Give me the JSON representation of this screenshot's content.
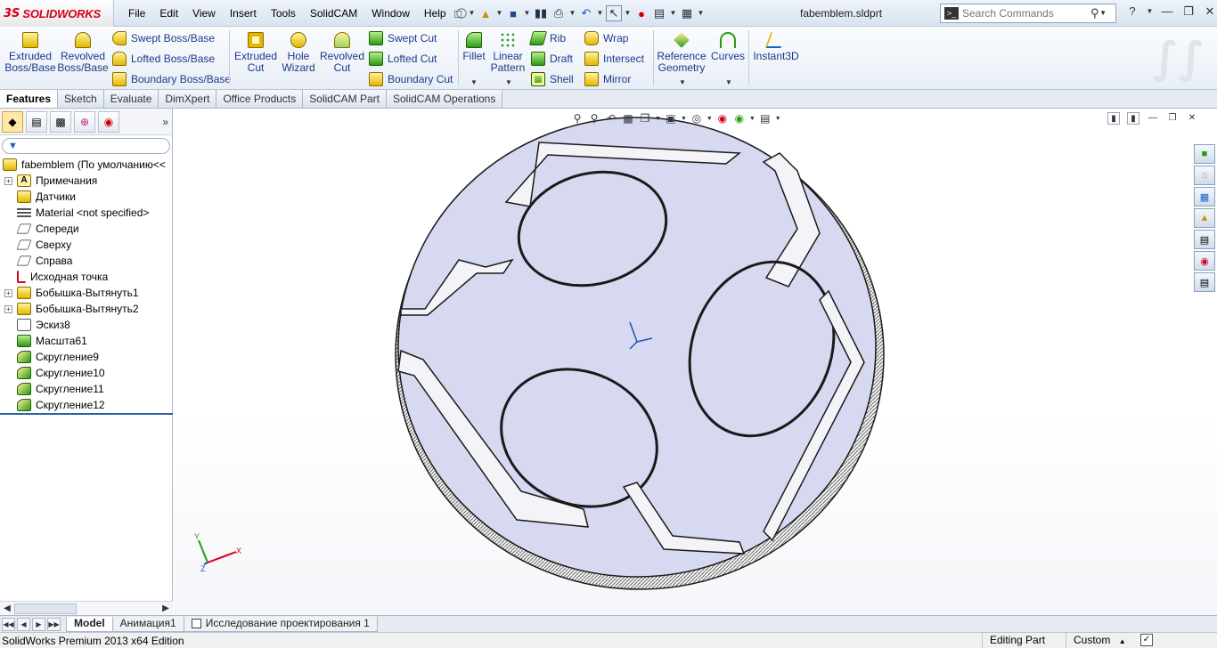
{
  "app": {
    "logo_prefix": "3S",
    "logo_text": "SOLIDWORKS",
    "document_title": "fabemblem.sldprt"
  },
  "menu": [
    "File",
    "Edit",
    "View",
    "Insert",
    "Tools",
    "SolidCAM",
    "Window",
    "Help"
  ],
  "search": {
    "placeholder": "Search Commands"
  },
  "commands": {
    "extruded_boss": "Extruded Boss/Base",
    "revolved_boss": "Revolved Boss/Base",
    "swept_boss": "Swept Boss/Base",
    "lofted_boss": "Lofted Boss/Base",
    "boundary_boss": "Boundary Boss/Base",
    "extruded_cut": "Extruded Cut",
    "hole_wizard": "Hole Wizard",
    "revolved_cut": "Revolved Cut",
    "swept_cut": "Swept Cut",
    "lofted_cut": "Lofted Cut",
    "boundary_cut": "Boundary Cut",
    "fillet": "Fillet",
    "linear_pattern": "Linear Pattern",
    "rib": "Rib",
    "draft": "Draft",
    "shell": "Shell",
    "wrap": "Wrap",
    "intersect": "Intersect",
    "mirror": "Mirror",
    "reference_geometry": "Reference Geometry",
    "curves": "Curves",
    "instant3d": "Instant3D"
  },
  "tabs": [
    "Features",
    "Sketch",
    "Evaluate",
    "DimXpert",
    "Office Products",
    "SolidCAM Part",
    "SolidCAM Operations"
  ],
  "feature_tree": {
    "root": "fabemblem  (По умолчанию<<",
    "items": [
      {
        "label": "Примечания",
        "expandable": true,
        "icon": "note-icon"
      },
      {
        "label": "Датчики",
        "expandable": false,
        "icon": "sensor-icon"
      },
      {
        "label": "Material <not specified>",
        "expandable": false,
        "icon": "material-icon"
      },
      {
        "label": "Спереди",
        "expandable": false,
        "icon": "plane-icon"
      },
      {
        "label": "Сверху",
        "expandable": false,
        "icon": "plane-icon"
      },
      {
        "label": "Справа",
        "expandable": false,
        "icon": "plane-icon"
      },
      {
        "label": "Исходная точка",
        "expandable": false,
        "icon": "origin-icon"
      },
      {
        "label": "Бобышка-Вытянуть1",
        "expandable": true,
        "icon": "extrude-icon"
      },
      {
        "label": "Бобышка-Вытянуть2",
        "expandable": true,
        "icon": "extrude-icon"
      },
      {
        "label": "Эскиз8",
        "expandable": false,
        "icon": "sketch-icon"
      },
      {
        "label": "Масшта61",
        "expandable": false,
        "icon": "scale-icon"
      },
      {
        "label": "Скругление9",
        "expandable": false,
        "icon": "fillet-icon"
      },
      {
        "label": "Скругление10",
        "expandable": false,
        "icon": "fillet-icon"
      },
      {
        "label": "Скругление11",
        "expandable": false,
        "icon": "fillet-icon"
      },
      {
        "label": "Скругление12",
        "expandable": false,
        "icon": "fillet-icon"
      }
    ]
  },
  "bottom_tabs": [
    "Model",
    "Анимация1",
    "Исследование проектирования 1"
  ],
  "status": {
    "edition": "SolidWorks Premium 2013 x64 Edition",
    "mode": "Editing Part",
    "units": "Custom"
  },
  "colors": {
    "part_face": "#d6d9f0",
    "part_edge": "#1a1a1a",
    "brand_red": "#d4001c"
  }
}
